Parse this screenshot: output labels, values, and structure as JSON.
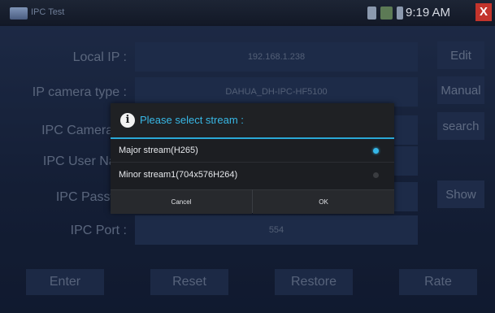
{
  "statusbar": {
    "app_title": "IPC Test",
    "time": "9:19 AM",
    "close": "X"
  },
  "form": {
    "local_ip_label": "Local IP :",
    "local_ip_value": "192.168.1.238",
    "camera_type_label": "IP camera type :",
    "camera_type_value": "DAHUA_DH-IPC-HF5100",
    "cameras_label": "IPC Cameras I",
    "user_label": "IPC User Nam",
    "password_label": "IPC Passwo",
    "port_label": "IPC Port :",
    "port_value": "554"
  },
  "side_buttons": {
    "edit": "Edit",
    "manual": "Manual",
    "search": "search",
    "show": "Show"
  },
  "bottom_buttons": {
    "enter": "Enter",
    "reset": "Reset",
    "restore": "Restore",
    "rate": "Rate"
  },
  "dialog": {
    "icon": "info-icon",
    "title": "Please select stream :",
    "options": [
      {
        "label": "Major stream(H265)",
        "selected": true
      },
      {
        "label": "Minor stream1(704x576H264)",
        "selected": false
      }
    ],
    "cancel": "Cancel",
    "ok": "OK"
  },
  "colors": {
    "accent": "#35b7e8",
    "close": "#c3342c"
  }
}
